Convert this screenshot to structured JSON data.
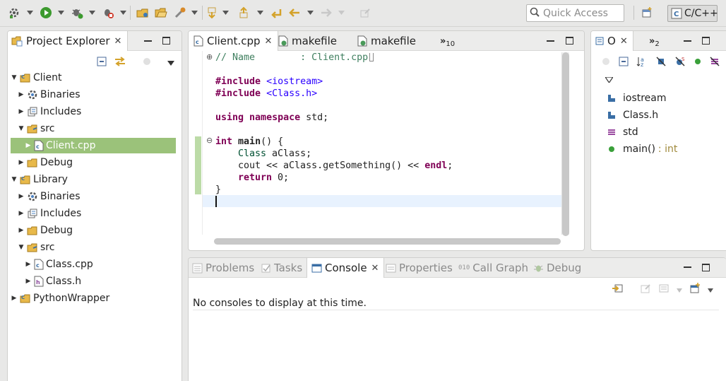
{
  "toolbar": {
    "icons": [
      "build-icon",
      "run-icon",
      "debug-icon",
      "stop-icon",
      "new-project-icon",
      "open-folder-icon",
      "tool-icon",
      "next-annotation-icon",
      "prev-annotation-icon",
      "back-icon",
      "forward-icon",
      "pin-icon"
    ],
    "quick_access_placeholder": "Quick Access",
    "perspective_label": "C/C++"
  },
  "project_explorer": {
    "title": "Project Explorer",
    "items": [
      {
        "label": "Client",
        "icon": "project-icon",
        "expanded": true
      },
      {
        "label": "Binaries",
        "icon": "binaries-icon",
        "expanded": false
      },
      {
        "label": "Includes",
        "icon": "includes-icon",
        "expanded": false
      },
      {
        "label": "src",
        "icon": "folder-icon",
        "expanded": true
      },
      {
        "label": "Client.cpp",
        "icon": "cpp-file-icon",
        "selected": true
      },
      {
        "label": "Debug",
        "icon": "folder-icon",
        "expanded": false
      },
      {
        "label": "Library",
        "icon": "project-icon",
        "expanded": true
      },
      {
        "label": "Binaries",
        "icon": "binaries-icon",
        "expanded": false
      },
      {
        "label": "Includes",
        "icon": "includes-icon",
        "expanded": false
      },
      {
        "label": "Debug",
        "icon": "folder-icon",
        "expanded": false
      },
      {
        "label": "src",
        "icon": "folder-icon",
        "expanded": true
      },
      {
        "label": "Class.cpp",
        "icon": "cpp-file-icon"
      },
      {
        "label": "Class.h",
        "icon": "h-file-icon"
      },
      {
        "label": "PythonWrapper",
        "icon": "project-icon",
        "expanded": false
      }
    ]
  },
  "editor": {
    "tabs": [
      {
        "label": "Client.cpp",
        "active": true
      },
      {
        "label": "makefile"
      },
      {
        "label": "makefile"
      }
    ],
    "overflow_count": "10",
    "lines": {
      "l1_comment": "// Name        : Client.cpp",
      "l2_kw": "#include",
      "l2_str": "<iostream>",
      "l3_kw": "#include",
      "l3_str": "<Class.h>",
      "l4_kw1": "using",
      "l4_kw2": "namespace",
      "l4_rest": "std;",
      "l5_kw": "int",
      "l5_fn": "main",
      "l5_rest": "() {",
      "l6_type": "Class",
      "l6_rest": " aClass;",
      "l7_a": "cout << aClass.getSomething() << ",
      "l7_kw": "endl",
      "l7_b": ";",
      "l8_kw": "return",
      "l8_rest": " 0;",
      "l9": "}"
    }
  },
  "outline": {
    "tab_label": "O",
    "overflow_count": "2",
    "items": [
      {
        "label": "iostream",
        "icon": "include-icon"
      },
      {
        "label": "Class.h",
        "icon": "include-icon"
      },
      {
        "label": "std",
        "icon": "namespace-icon"
      },
      {
        "label": "main()",
        "type": ": int",
        "icon": "function-icon"
      }
    ]
  },
  "bottom_panel": {
    "tabs": [
      {
        "label": "Problems",
        "icon": "problems-icon"
      },
      {
        "label": "Tasks",
        "icon": "tasks-icon"
      },
      {
        "label": "Console",
        "icon": "console-icon",
        "active": true
      },
      {
        "label": "Properties",
        "icon": "properties-icon"
      },
      {
        "label": "Call Graph",
        "icon": "call-graph-icon"
      },
      {
        "label": "Debug",
        "icon": "debug-icon"
      }
    ],
    "message": "No consoles to display at this time."
  },
  "colors": {
    "selection": "#9bc27a",
    "keyword": "#7f0055",
    "string": "#2a00ff",
    "comment": "#3f7f5f",
    "current_line": "#e8f2fe",
    "changed_marker": "#a6cf8a"
  }
}
